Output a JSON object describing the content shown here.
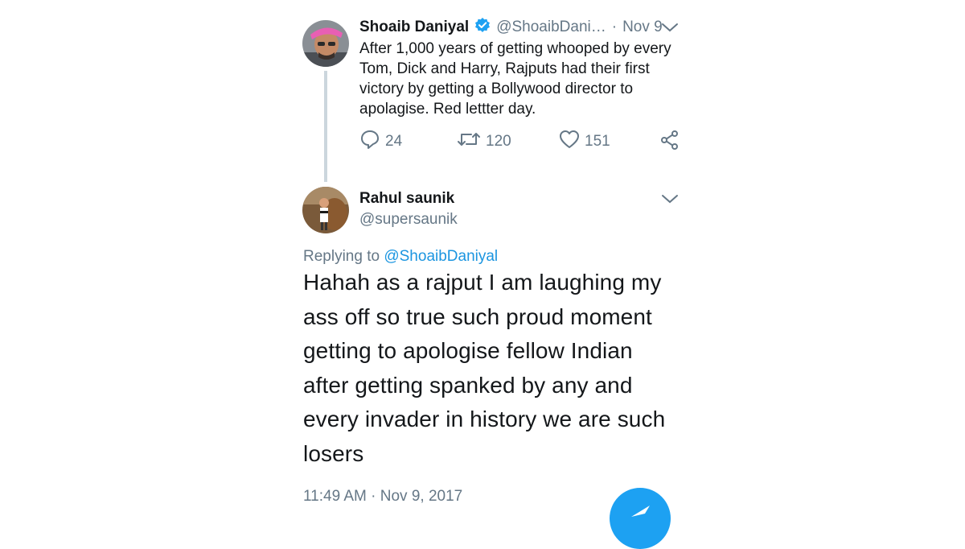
{
  "parent_tweet": {
    "author_name": "Shoaib Daniyal",
    "handle": "@ShoaibDani…",
    "separator": "·",
    "date": "Nov 9",
    "text_lines": [
      "After 1,000 years of getting whooped by every",
      "Tom, Dick and Harry, Rajputs had their first",
      "victory by getting a Bollywood director to",
      "apolagise. Red lettter day."
    ],
    "replies": "24",
    "retweets": "120",
    "likes": "151"
  },
  "reply_tweet": {
    "author_name": "Rahul saunik",
    "handle": "@supersaunik",
    "replying_prefix": "Replying to",
    "replying_to": "@ShoaibDaniyal",
    "text_lines": [
      "Hahah as a rajput I am laughing my",
      "ass off so true such proud moment",
      "getting to apologise fellow Indian",
      "after getting spanked by any and",
      "every invader in history we are such",
      "losers"
    ],
    "timestamp": "11:49 AM · Nov 9, 2017"
  },
  "icons": {
    "reply": "reply-icon",
    "retweet": "retweet-icon",
    "like": "heart-icon",
    "share": "share-icon",
    "menu": "chevron-down-icon",
    "verified": "verified-badge-icon",
    "fab": "compose-fab-icon"
  },
  "colors": {
    "accent": "#1da1f2",
    "link": "#1b95e0",
    "muted": "#657786",
    "thread_line": "#ccd6dd"
  }
}
